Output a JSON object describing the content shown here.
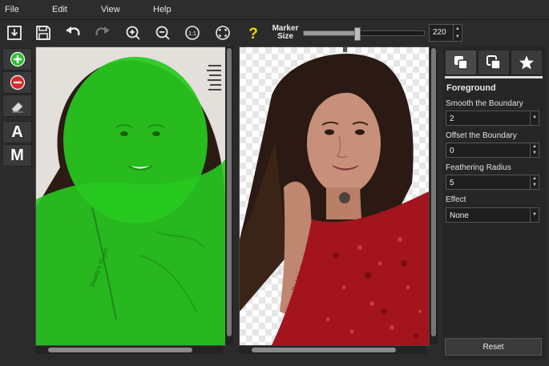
{
  "menu": [
    "File",
    "Edit",
    "View",
    "Help"
  ],
  "toolbar": {
    "icons": [
      "import-icon",
      "save-icon",
      "undo-icon",
      "redo-icon",
      "zoom-in-icon",
      "zoom-out-icon",
      "actual-size-icon",
      "fit-to-window-icon",
      "help-icon"
    ],
    "marker_label_line1": "Marker",
    "marker_label_line2": "Size",
    "marker_size_value": "220",
    "marker_slider_fraction": 0.44
  },
  "left_tools": {
    "add_icon": "plus-circle-icon",
    "remove_icon": "minus-circle-icon",
    "eraser_icon": "eraser-icon",
    "auto_label": "A",
    "manual_label": "M"
  },
  "panel": {
    "tabs": [
      "foreground-tab-icon",
      "background-tab-icon",
      "effects-star-icon"
    ],
    "section_title": "Foreground",
    "smooth_label": "Smooth the Boundary",
    "smooth_value": "2",
    "offset_label": "Offset the Boundary",
    "offset_value": "0",
    "feather_label": "Feathering Radius",
    "feather_value": "5",
    "effect_label": "Effect",
    "effect_value": "None",
    "reset_label": "Reset"
  },
  "colors": {
    "mask_green": "#27c91f",
    "dress_red": "#a3141c",
    "help_yellow": "#f2d200",
    "add_green": "#2fbf2f",
    "remove_red": "#d52b2b"
  }
}
